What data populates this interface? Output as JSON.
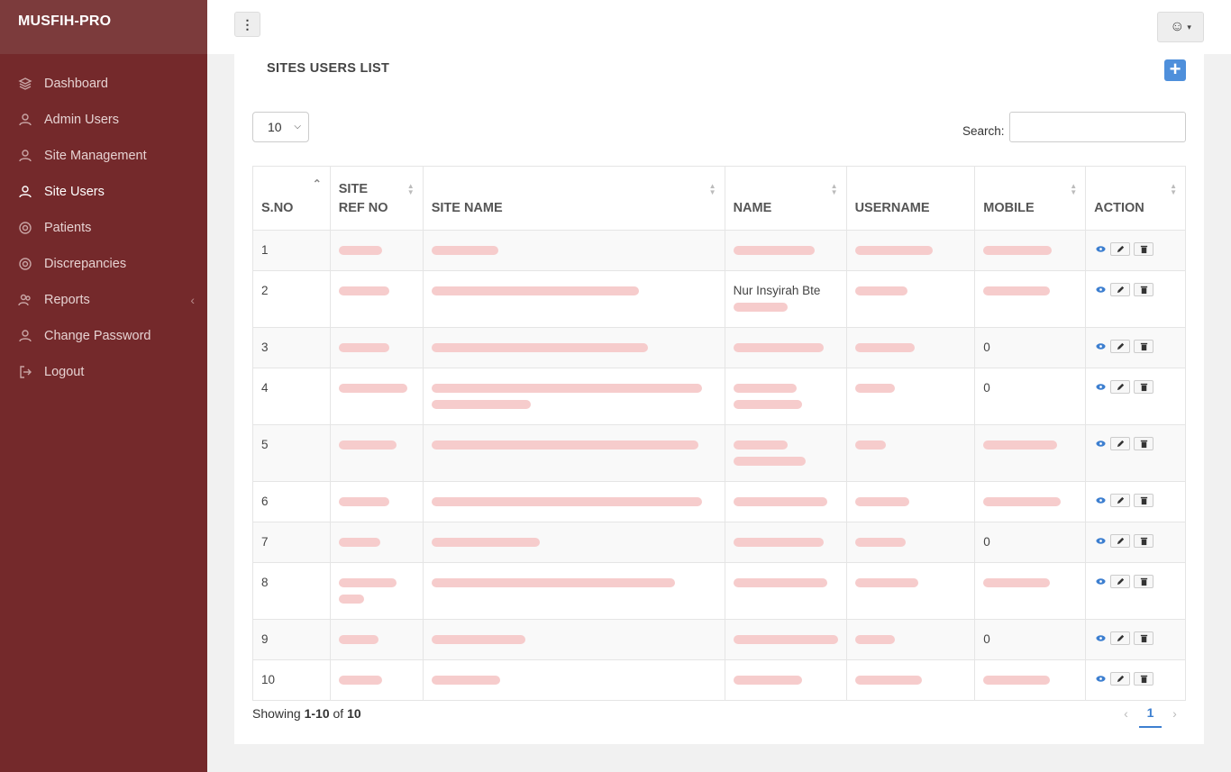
{
  "app": {
    "brand": "MUSFIH-PRO"
  },
  "sidebar": {
    "items": [
      {
        "label": "Dashboard",
        "icon": "layers-icon"
      },
      {
        "label": "Admin Users",
        "icon": "user-icon"
      },
      {
        "label": "Site Management",
        "icon": "user-icon"
      },
      {
        "label": "Site Users",
        "icon": "user-icon",
        "active": true
      },
      {
        "label": "Patients",
        "icon": "lifebuoy-icon"
      },
      {
        "label": "Discrepancies",
        "icon": "lifebuoy-icon"
      },
      {
        "label": "Reports",
        "icon": "users-icon",
        "caret": "‹"
      },
      {
        "label": "Change Password",
        "icon": "user-icon"
      },
      {
        "label": "Logout",
        "icon": "logout-icon"
      }
    ]
  },
  "topbar": {
    "kebab": "⋮",
    "user_menu": "☺",
    "user_menu_caret": "▾"
  },
  "card": {
    "title": "SITES USERS LIST",
    "add_label": "+"
  },
  "controls": {
    "page_length": "10",
    "search_label": "Search:",
    "search_value": ""
  },
  "table": {
    "headers": [
      {
        "line1": "",
        "line2": "S.NO"
      },
      {
        "line1": "SITE",
        "line2": "REF NO"
      },
      {
        "line1": "",
        "line2": "SITE NAME"
      },
      {
        "line1": "",
        "line2": "NAME"
      },
      {
        "line1": "",
        "line2": "USERNAME"
      },
      {
        "line1": "",
        "line2": "MOBILE"
      },
      {
        "line1": "",
        "line2": "ACTION"
      }
    ],
    "rows": [
      {
        "sno": "1",
        "mobile": ""
      },
      {
        "sno": "2",
        "name_prefix": "Nur Insyirah Bte",
        "mobile": ""
      },
      {
        "sno": "3",
        "mobile": "0"
      },
      {
        "sno": "4",
        "mobile": "0"
      },
      {
        "sno": "5",
        "mobile": ""
      },
      {
        "sno": "6",
        "mobile": ""
      },
      {
        "sno": "7",
        "mobile": "0"
      },
      {
        "sno": "8",
        "mobile": ""
      },
      {
        "sno": "9",
        "mobile": "0"
      },
      {
        "sno": "10",
        "mobile": ""
      }
    ]
  },
  "footer": {
    "info_prefix": "Showing ",
    "info_range": "1-10",
    "info_of": " of ",
    "info_total": "10",
    "pager_prev": "‹",
    "pager_current": "1",
    "pager_next": "›"
  },
  "colors": {
    "sidebar_bg": "#74292b",
    "brand_bg": "#7c3b3c",
    "accent": "#4e8fdb"
  }
}
